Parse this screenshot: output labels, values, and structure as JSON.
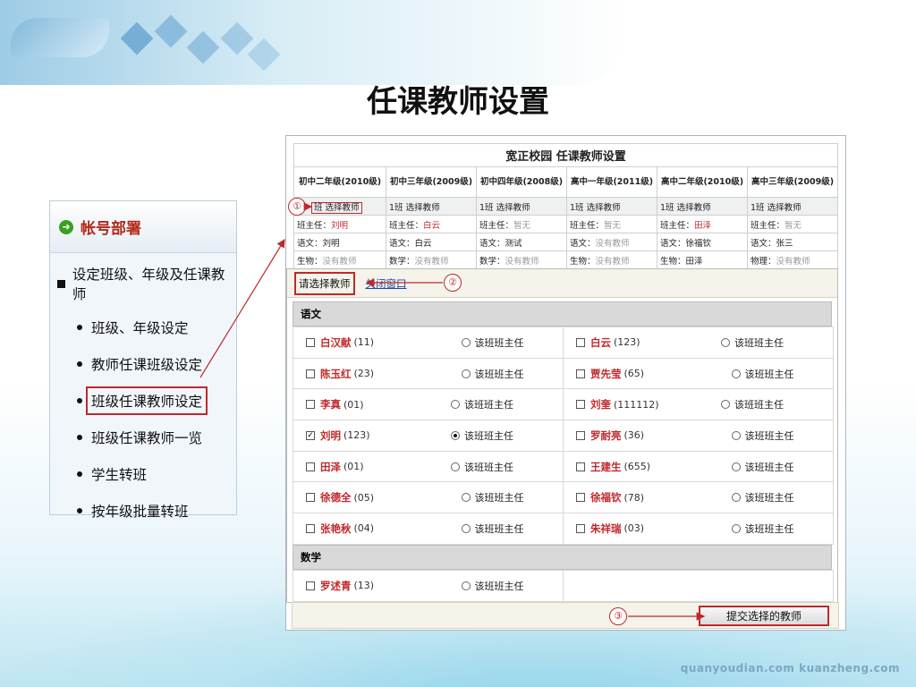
{
  "decor": {
    "logo_text": "",
    "watermark": "quanyoudian.com  kuanzheng.com"
  },
  "page_title": "任课教师设置",
  "menu": {
    "header": "帐号部署",
    "section": "设定班级、年级及任课教师",
    "items": [
      {
        "label": "班级、年级设定",
        "highlighted": false
      },
      {
        "label": "教师任课班级设定",
        "highlighted": false
      },
      {
        "label": "班级任课教师设定",
        "highlighted": true
      },
      {
        "label": "班级任课教师一览",
        "highlighted": false
      },
      {
        "label": "学生转班",
        "highlighted": false
      },
      {
        "label": "按年级批量转班",
        "highlighted": false
      }
    ]
  },
  "top_table": {
    "title": "宽正校园  任课教师设置",
    "grades": [
      "初中二年级(2010级)",
      "初中三年级(2009级)",
      "初中四年级(2008级)",
      "高中一年级(2011级)",
      "高中二年级(2010级)",
      "高中三年级(2009级)"
    ],
    "class_row": [
      "班  选择教师",
      "1班  选择教师",
      "1班  选择教师",
      "1班  选择教师",
      "1班  选择教师",
      "1班  选择教师"
    ],
    "head_row": [
      {
        "label": "班主任：",
        "value": "刘明",
        "style": "red"
      },
      {
        "label": "班主任：",
        "value": "白云",
        "style": "red"
      },
      {
        "label": "班主任：",
        "value": "暂无",
        "style": "gray"
      },
      {
        "label": "班主任：",
        "value": "暂无",
        "style": "gray"
      },
      {
        "label": "班主任：",
        "value": "田泽",
        "style": "red"
      },
      {
        "label": "班主任：",
        "value": "暂无",
        "style": "gray"
      }
    ],
    "subject_row": [
      {
        "label": "语文：",
        "value": "刘明",
        "style": ""
      },
      {
        "label": "语文：",
        "value": "白云",
        "style": ""
      },
      {
        "label": "语文：",
        "value": "测试",
        "style": ""
      },
      {
        "label": "语文：",
        "value": "没有教师",
        "style": "gray"
      },
      {
        "label": "语文：",
        "value": "徐福钦",
        "style": ""
      },
      {
        "label": "语文：",
        "value": "张三",
        "style": ""
      }
    ],
    "subject_row2": [
      {
        "label": "生物：",
        "value": "没有教师",
        "style": "gray"
      },
      {
        "label": "数学：",
        "value": "没有教师",
        "style": "gray"
      },
      {
        "label": "数学：",
        "value": "没有教师",
        "style": "gray"
      },
      {
        "label": "生物：",
        "value": "没有教师",
        "style": "gray"
      },
      {
        "label": "生物：",
        "value": "田泽",
        "style": ""
      },
      {
        "label": "物理：",
        "value": "没有教师",
        "style": "gray"
      }
    ]
  },
  "dialog": {
    "title": "请选择教师",
    "close_link": "关闭窗口",
    "role_label": "该班班主任",
    "subjects": [
      {
        "name": "语文",
        "teachers": [
          {
            "name": "白汉献",
            "code": "(11)",
            "checked": false,
            "head": false
          },
          {
            "name": "白云",
            "code": "(123)",
            "checked": false,
            "head": false
          },
          {
            "name": "陈玉红",
            "code": "(23)",
            "checked": false,
            "head": false
          },
          {
            "name": "贾先莹",
            "code": "(65)",
            "checked": false,
            "head": false
          },
          {
            "name": "李真",
            "code": "(01)",
            "checked": false,
            "head": false
          },
          {
            "name": "刘奎",
            "code": "(111112)",
            "checked": false,
            "head": false
          },
          {
            "name": "刘明",
            "code": "(123)",
            "checked": true,
            "head": true
          },
          {
            "name": "罗耐亮",
            "code": "(36)",
            "checked": false,
            "head": false
          },
          {
            "name": "田泽",
            "code": "(01)",
            "checked": false,
            "head": false
          },
          {
            "name": "王建生",
            "code": "(655)",
            "checked": false,
            "head": false
          },
          {
            "name": "徐德全",
            "code": "(05)",
            "checked": false,
            "head": false
          },
          {
            "name": "徐福钦",
            "code": "(78)",
            "checked": false,
            "head": false
          },
          {
            "name": "张艳秋",
            "code": "(04)",
            "checked": false,
            "head": false
          },
          {
            "name": "朱祥瑞",
            "code": "(03)",
            "checked": false,
            "head": false
          }
        ]
      },
      {
        "name": "数学",
        "teachers": [
          {
            "name": "罗述青",
            "code": "(13)",
            "checked": false,
            "head": false
          }
        ]
      }
    ],
    "submit_label": "提交选择的教师"
  },
  "markers": [
    "①",
    "②",
    "③"
  ],
  "colors": {
    "accent_red": "#c0292b",
    "link_blue": "#1d49a5",
    "menu_header_red": "#b22a1a"
  }
}
